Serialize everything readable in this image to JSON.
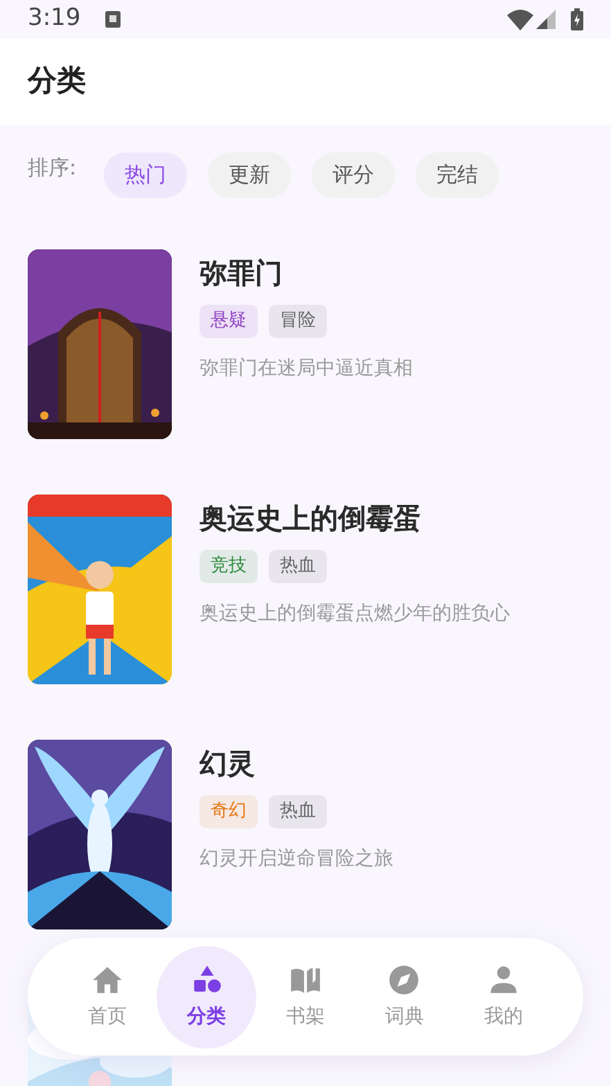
{
  "status_bar": {
    "time": "3:19"
  },
  "header": {
    "title": "分类"
  },
  "sort": {
    "label": "排序:",
    "options": [
      {
        "label": "热门",
        "selected": true
      },
      {
        "label": "更新",
        "selected": false
      },
      {
        "label": "评分",
        "selected": false
      },
      {
        "label": "完结",
        "selected": false
      }
    ]
  },
  "books": [
    {
      "title": "弥罪门",
      "cover": {
        "kind": "picture"
      },
      "tags": [
        {
          "label": "悬疑",
          "color": "#8e3fc0"
        },
        {
          "label": "冒险",
          "color": "#666666"
        }
      ],
      "summary": "弥罪门在迷局中逼近真相"
    },
    {
      "title": "奥运史上的倒霉蛋",
      "cover": {
        "kind": "picture"
      },
      "tags": [
        {
          "label": "竞技",
          "color": "#2e8b3e"
        },
        {
          "label": "热血",
          "color": "#666666"
        }
      ],
      "summary": "奥运史上的倒霉蛋点燃少年的胜负心"
    },
    {
      "title": "幻灵",
      "cover": {
        "kind": "picture"
      },
      "tags": [
        {
          "label": "奇幻",
          "color": "#e67816"
        },
        {
          "label": "热血",
          "color": "#666666"
        }
      ],
      "summary": "幻灵开启逆命冒险之旅"
    },
    {
      "cover": {
        "kind": "picture"
      }
    }
  ],
  "nav": [
    {
      "label": "首页",
      "selected": false
    },
    {
      "label": "分类",
      "selected": true
    },
    {
      "label": "书架",
      "selected": false
    },
    {
      "label": "词典",
      "selected": false
    },
    {
      "label": "我的",
      "selected": false
    }
  ]
}
